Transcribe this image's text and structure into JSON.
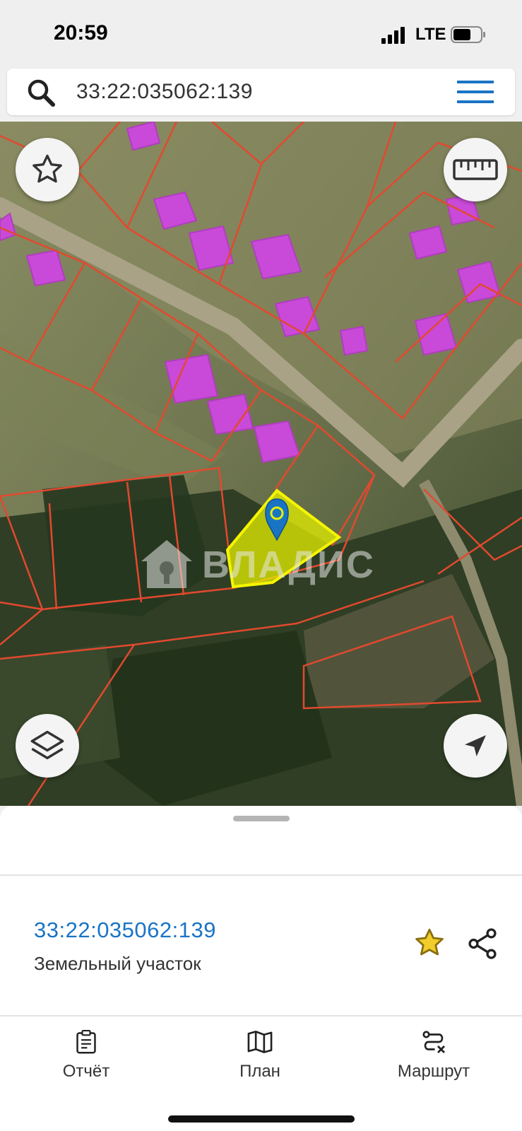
{
  "status_bar": {
    "time": "20:59",
    "network": "LTE",
    "icons": [
      "signal-icon",
      "battery-icon"
    ]
  },
  "search": {
    "value": "33:22:035062:139",
    "icon": "search-icon",
    "menu_icon": "hamburger-menu-icon"
  },
  "map": {
    "watermark": "ВЛАДИС",
    "buttons": [
      "star-icon",
      "ruler-icon",
      "layers-icon",
      "navigation-arrow-icon"
    ],
    "colors": {
      "parcel_border": "#e2492f",
      "selected_fill": "#e6f000",
      "selected_border": "#f5f500",
      "building": "#c94ad8",
      "pin": "#1a74c4"
    }
  },
  "sheet": {
    "cadastral_number": "33:22:035062:139",
    "object_type": "Земельный участок",
    "star_color": "#e2b50c",
    "icons": [
      "star-icon",
      "share-icon"
    ]
  },
  "tabs": [
    {
      "label": "Отчёт",
      "icon": "report-icon"
    },
    {
      "label": "План",
      "icon": "map-plan-icon"
    },
    {
      "label": "Маршрут",
      "icon": "route-icon"
    }
  ],
  "accent": "#1a74c4"
}
